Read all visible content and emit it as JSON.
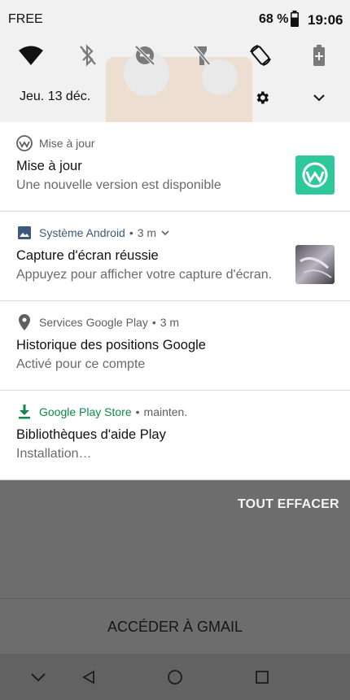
{
  "status_bar": {
    "carrier": "FREE",
    "battery_percent": "68 %",
    "time": "19:06"
  },
  "quick_settings": {
    "tiles": [
      "wifi-icon",
      "bluetooth-off-icon",
      "do-not-disturb-off-icon",
      "flashlight-off-icon",
      "auto-rotate-icon",
      "battery-saver-icon"
    ]
  },
  "header": {
    "date": "Jeu. 13 déc."
  },
  "notifications": [
    {
      "app": "Mise à jour",
      "time": "",
      "title": "Mise à jour",
      "text": "Une nouvelle version est disponible",
      "accent": "#5f5f5f"
    },
    {
      "app": "Système Android",
      "time": "3 m",
      "title": "Capture d'écran réussie",
      "text": "Appuyez pour afficher votre capture d'écran.",
      "accent": "#3d5a7a"
    },
    {
      "app": "Services Google Play",
      "time": "3 m",
      "title": "Historique des positions Google",
      "text": "Activé pour ce compte",
      "accent": "#5f5f5f"
    },
    {
      "app": "Google Play Store",
      "time": "mainten.",
      "title": "Bibliothèques d'aide Play",
      "text": "Installation…",
      "accent": "#0f8a4b"
    }
  ],
  "clear_all_label": "TOUT EFFACER",
  "gmail_label": "ACCÉDER À GMAIL",
  "colors": {
    "update_icon_bg": "#2ec89a",
    "play_store_green": "#0f8a4b",
    "scrim": "#6d6d6d"
  }
}
